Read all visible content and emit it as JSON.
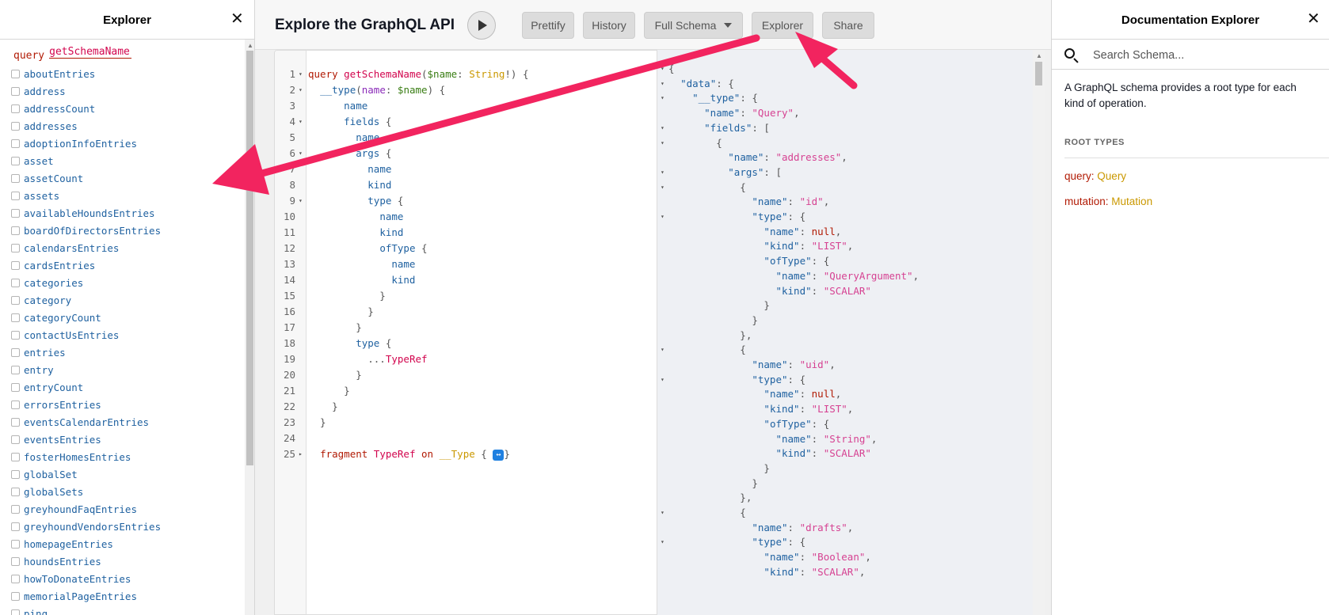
{
  "explorer": {
    "title": "Explorer",
    "close_symbol": "✕",
    "query_keyword": "query",
    "query_name": "getSchemaName",
    "fields": [
      "aboutEntries",
      "address",
      "addressCount",
      "addresses",
      "adoptionInfoEntries",
      "asset",
      "assetCount",
      "assets",
      "availableHoundsEntries",
      "boardOfDirectorsEntries",
      "calendarsEntries",
      "cardsEntries",
      "categories",
      "category",
      "categoryCount",
      "contactUsEntries",
      "entries",
      "entry",
      "entryCount",
      "errorsEntries",
      "eventsCalendarEntries",
      "eventsEntries",
      "fosterHomesEntries",
      "globalSet",
      "globalSets",
      "greyhoundFaqEntries",
      "greyhoundVendorsEntries",
      "homepageEntries",
      "houndsEntries",
      "howToDonateEntries",
      "memorialPageEntries",
      "ping"
    ]
  },
  "toolbar": {
    "app_title": "Explore the GraphQL API",
    "run_icon": "play-icon",
    "prettify": "Prettify",
    "history": "History",
    "full_schema": "Full Schema",
    "explorer": "Explorer",
    "share": "Share"
  },
  "editor": {
    "lines": [
      {
        "n": "1",
        "fold": "▾",
        "tokens": [
          [
            "kw",
            "query "
          ],
          [
            "def",
            "getSchemaName"
          ],
          [
            "punct",
            "("
          ],
          [
            "var",
            "$name"
          ],
          [
            "punct",
            ": "
          ],
          [
            "type",
            "String"
          ],
          [
            "punct",
            "!) {"
          ]
        ]
      },
      {
        "n": "2",
        "fold": "▾",
        "tokens": [
          [
            "punct",
            "  "
          ],
          [
            "prop",
            "__type"
          ],
          [
            "punct",
            "("
          ],
          [
            "at",
            "name"
          ],
          [
            "punct",
            ": "
          ],
          [
            "var",
            "$name"
          ],
          [
            "punct",
            ") {"
          ]
        ]
      },
      {
        "n": "3",
        "fold": "",
        "tokens": [
          [
            "punct",
            "      "
          ],
          [
            "prop",
            "name"
          ]
        ]
      },
      {
        "n": "4",
        "fold": "▾",
        "tokens": [
          [
            "punct",
            "      "
          ],
          [
            "prop",
            "fields"
          ],
          [
            "punct",
            " {"
          ]
        ]
      },
      {
        "n": "5",
        "fold": "",
        "tokens": [
          [
            "punct",
            "        "
          ],
          [
            "prop",
            "name"
          ]
        ]
      },
      {
        "n": "6",
        "fold": "▾",
        "tokens": [
          [
            "punct",
            "        "
          ],
          [
            "prop",
            "args"
          ],
          [
            "punct",
            " {"
          ]
        ]
      },
      {
        "n": "7",
        "fold": "",
        "tokens": [
          [
            "punct",
            "          "
          ],
          [
            "prop",
            "name"
          ]
        ]
      },
      {
        "n": "8",
        "fold": "",
        "tokens": [
          [
            "punct",
            "          "
          ],
          [
            "prop",
            "kind"
          ]
        ]
      },
      {
        "n": "9",
        "fold": "▾",
        "tokens": [
          [
            "punct",
            "          "
          ],
          [
            "prop",
            "type"
          ],
          [
            "punct",
            " {"
          ]
        ]
      },
      {
        "n": "10",
        "fold": "",
        "tokens": [
          [
            "punct",
            "            "
          ],
          [
            "prop",
            "name"
          ]
        ]
      },
      {
        "n": "11",
        "fold": "",
        "tokens": [
          [
            "punct",
            "            "
          ],
          [
            "prop",
            "kind"
          ]
        ]
      },
      {
        "n": "12",
        "fold": "",
        "tokens": [
          [
            "punct",
            "            "
          ],
          [
            "prop",
            "ofType"
          ],
          [
            "punct",
            " {"
          ]
        ]
      },
      {
        "n": "13",
        "fold": "",
        "tokens": [
          [
            "punct",
            "              "
          ],
          [
            "prop",
            "name"
          ]
        ]
      },
      {
        "n": "14",
        "fold": "",
        "tokens": [
          [
            "punct",
            "              "
          ],
          [
            "prop",
            "kind"
          ]
        ]
      },
      {
        "n": "15",
        "fold": "",
        "tokens": [
          [
            "punct",
            "            }"
          ]
        ]
      },
      {
        "n": "16",
        "fold": "",
        "tokens": [
          [
            "punct",
            "          }"
          ]
        ]
      },
      {
        "n": "17",
        "fold": "",
        "tokens": [
          [
            "punct",
            "        }"
          ]
        ]
      },
      {
        "n": "18",
        "fold": "",
        "tokens": [
          [
            "punct",
            "        "
          ],
          [
            "prop",
            "type"
          ],
          [
            "punct",
            " {"
          ]
        ]
      },
      {
        "n": "19",
        "fold": "",
        "tokens": [
          [
            "punct",
            "          ..."
          ],
          [
            "frag",
            "TypeRef"
          ]
        ]
      },
      {
        "n": "20",
        "fold": "",
        "tokens": [
          [
            "punct",
            "        }"
          ]
        ]
      },
      {
        "n": "21",
        "fold": "",
        "tokens": [
          [
            "punct",
            "      }"
          ]
        ]
      },
      {
        "n": "22",
        "fold": "",
        "tokens": [
          [
            "punct",
            "    }"
          ]
        ]
      },
      {
        "n": "23",
        "fold": "",
        "tokens": [
          [
            "punct",
            "  }"
          ]
        ]
      },
      {
        "n": "24",
        "fold": "",
        "tokens": []
      },
      {
        "n": "25",
        "fold": "▸",
        "tokens": [
          [
            "punct",
            "  "
          ],
          [
            "kw",
            "fragment "
          ],
          [
            "frag",
            "TypeRef"
          ],
          [
            "kw",
            " on "
          ],
          [
            "type",
            "__Type"
          ],
          [
            "punct",
            " { "
          ],
          [
            "chip",
            "↔"
          ],
          [
            "punct",
            "}"
          ]
        ]
      }
    ]
  },
  "result": {
    "lines": [
      {
        "fold": "▾",
        "tokens": [
          [
            "punct",
            "{"
          ]
        ]
      },
      {
        "fold": "▾",
        "tokens": [
          [
            "punct",
            "  "
          ],
          [
            "key",
            "\"data\""
          ],
          [
            "punct",
            ": {"
          ]
        ]
      },
      {
        "fold": "▾",
        "tokens": [
          [
            "punct",
            "    "
          ],
          [
            "key",
            "\"__type\""
          ],
          [
            "punct",
            ": {"
          ]
        ]
      },
      {
        "fold": "",
        "tokens": [
          [
            "punct",
            "      "
          ],
          [
            "key",
            "\"name\""
          ],
          [
            "punct",
            ": "
          ],
          [
            "str",
            "\"Query\""
          ],
          [
            "punct",
            ","
          ]
        ]
      },
      {
        "fold": "▾",
        "tokens": [
          [
            "punct",
            "      "
          ],
          [
            "key",
            "\"fields\""
          ],
          [
            "punct",
            ": ["
          ]
        ]
      },
      {
        "fold": "▾",
        "tokens": [
          [
            "punct",
            "        {"
          ]
        ]
      },
      {
        "fold": "",
        "tokens": [
          [
            "punct",
            "          "
          ],
          [
            "key",
            "\"name\""
          ],
          [
            "punct",
            ": "
          ],
          [
            "str",
            "\"addresses\""
          ],
          [
            "punct",
            ","
          ]
        ]
      },
      {
        "fold": "▾",
        "tokens": [
          [
            "punct",
            "          "
          ],
          [
            "key",
            "\"args\""
          ],
          [
            "punct",
            ": ["
          ]
        ]
      },
      {
        "fold": "▾",
        "tokens": [
          [
            "punct",
            "            {"
          ]
        ]
      },
      {
        "fold": "",
        "tokens": [
          [
            "punct",
            "              "
          ],
          [
            "key",
            "\"name\""
          ],
          [
            "punct",
            ": "
          ],
          [
            "str",
            "\"id\""
          ],
          [
            "punct",
            ","
          ]
        ]
      },
      {
        "fold": "▾",
        "tokens": [
          [
            "punct",
            "              "
          ],
          [
            "key",
            "\"type\""
          ],
          [
            "punct",
            ": {"
          ]
        ]
      },
      {
        "fold": "",
        "tokens": [
          [
            "punct",
            "                "
          ],
          [
            "key",
            "\"name\""
          ],
          [
            "punct",
            ": "
          ],
          [
            "null",
            "null"
          ],
          [
            "punct",
            ","
          ]
        ]
      },
      {
        "fold": "",
        "tokens": [
          [
            "punct",
            "                "
          ],
          [
            "key",
            "\"kind\""
          ],
          [
            "punct",
            ": "
          ],
          [
            "str",
            "\"LIST\""
          ],
          [
            "punct",
            ","
          ]
        ]
      },
      {
        "fold": "",
        "tokens": [
          [
            "punct",
            "                "
          ],
          [
            "key",
            "\"ofType\""
          ],
          [
            "punct",
            ": {"
          ]
        ]
      },
      {
        "fold": "",
        "tokens": [
          [
            "punct",
            "                  "
          ],
          [
            "key",
            "\"name\""
          ],
          [
            "punct",
            ": "
          ],
          [
            "str",
            "\"QueryArgument\""
          ],
          [
            "punct",
            ","
          ]
        ]
      },
      {
        "fold": "",
        "tokens": [
          [
            "punct",
            "                  "
          ],
          [
            "key",
            "\"kind\""
          ],
          [
            "punct",
            ": "
          ],
          [
            "str",
            "\"SCALAR\""
          ]
        ]
      },
      {
        "fold": "",
        "tokens": [
          [
            "punct",
            "                }"
          ]
        ]
      },
      {
        "fold": "",
        "tokens": [
          [
            "punct",
            "              }"
          ]
        ]
      },
      {
        "fold": "",
        "tokens": [
          [
            "punct",
            "            },"
          ]
        ]
      },
      {
        "fold": "▾",
        "tokens": [
          [
            "punct",
            "            {"
          ]
        ]
      },
      {
        "fold": "",
        "tokens": [
          [
            "punct",
            "              "
          ],
          [
            "key",
            "\"name\""
          ],
          [
            "punct",
            ": "
          ],
          [
            "str",
            "\"uid\""
          ],
          [
            "punct",
            ","
          ]
        ]
      },
      {
        "fold": "▾",
        "tokens": [
          [
            "punct",
            "              "
          ],
          [
            "key",
            "\"type\""
          ],
          [
            "punct",
            ": {"
          ]
        ]
      },
      {
        "fold": "",
        "tokens": [
          [
            "punct",
            "                "
          ],
          [
            "key",
            "\"name\""
          ],
          [
            "punct",
            ": "
          ],
          [
            "null",
            "null"
          ],
          [
            "punct",
            ","
          ]
        ]
      },
      {
        "fold": "",
        "tokens": [
          [
            "punct",
            "                "
          ],
          [
            "key",
            "\"kind\""
          ],
          [
            "punct",
            ": "
          ],
          [
            "str",
            "\"LIST\""
          ],
          [
            "punct",
            ","
          ]
        ]
      },
      {
        "fold": "",
        "tokens": [
          [
            "punct",
            "                "
          ],
          [
            "key",
            "\"ofType\""
          ],
          [
            "punct",
            ": {"
          ]
        ]
      },
      {
        "fold": "",
        "tokens": [
          [
            "punct",
            "                  "
          ],
          [
            "key",
            "\"name\""
          ],
          [
            "punct",
            ": "
          ],
          [
            "str",
            "\"String\""
          ],
          [
            "punct",
            ","
          ]
        ]
      },
      {
        "fold": "",
        "tokens": [
          [
            "punct",
            "                  "
          ],
          [
            "key",
            "\"kind\""
          ],
          [
            "punct",
            ": "
          ],
          [
            "str",
            "\"SCALAR\""
          ]
        ]
      },
      {
        "fold": "",
        "tokens": [
          [
            "punct",
            "                }"
          ]
        ]
      },
      {
        "fold": "",
        "tokens": [
          [
            "punct",
            "              }"
          ]
        ]
      },
      {
        "fold": "",
        "tokens": [
          [
            "punct",
            "            },"
          ]
        ]
      },
      {
        "fold": "▾",
        "tokens": [
          [
            "punct",
            "            {"
          ]
        ]
      },
      {
        "fold": "",
        "tokens": [
          [
            "punct",
            "              "
          ],
          [
            "key",
            "\"name\""
          ],
          [
            "punct",
            ": "
          ],
          [
            "str",
            "\"drafts\""
          ],
          [
            "punct",
            ","
          ]
        ]
      },
      {
        "fold": "▾",
        "tokens": [
          [
            "punct",
            "              "
          ],
          [
            "key",
            "\"type\""
          ],
          [
            "punct",
            ": {"
          ]
        ]
      },
      {
        "fold": "",
        "tokens": [
          [
            "punct",
            "                "
          ],
          [
            "key",
            "\"name\""
          ],
          [
            "punct",
            ": "
          ],
          [
            "str",
            "\"Boolean\""
          ],
          [
            "punct",
            ","
          ]
        ]
      },
      {
        "fold": "",
        "tokens": [
          [
            "punct",
            "                "
          ],
          [
            "key",
            "\"kind\""
          ],
          [
            "punct",
            ": "
          ],
          [
            "str",
            "\"SCALAR\""
          ],
          [
            "punct",
            ","
          ]
        ]
      }
    ]
  },
  "docs": {
    "title": "Documentation Explorer",
    "close_symbol": "✕",
    "search_placeholder": "Search Schema...",
    "description": "A GraphQL schema provides a root type for each kind of operation.",
    "section_title": "ROOT TYPES",
    "root_types": [
      {
        "key": "query",
        "value": "Query"
      },
      {
        "key": "mutation",
        "value": "Mutation"
      }
    ]
  },
  "colors": {
    "annotation_arrow": "#f2245f",
    "keyword": "#b11a04",
    "definition": "#d2054e",
    "property": "#1f61a0",
    "string": "#d64292",
    "type": "#ca9800"
  }
}
